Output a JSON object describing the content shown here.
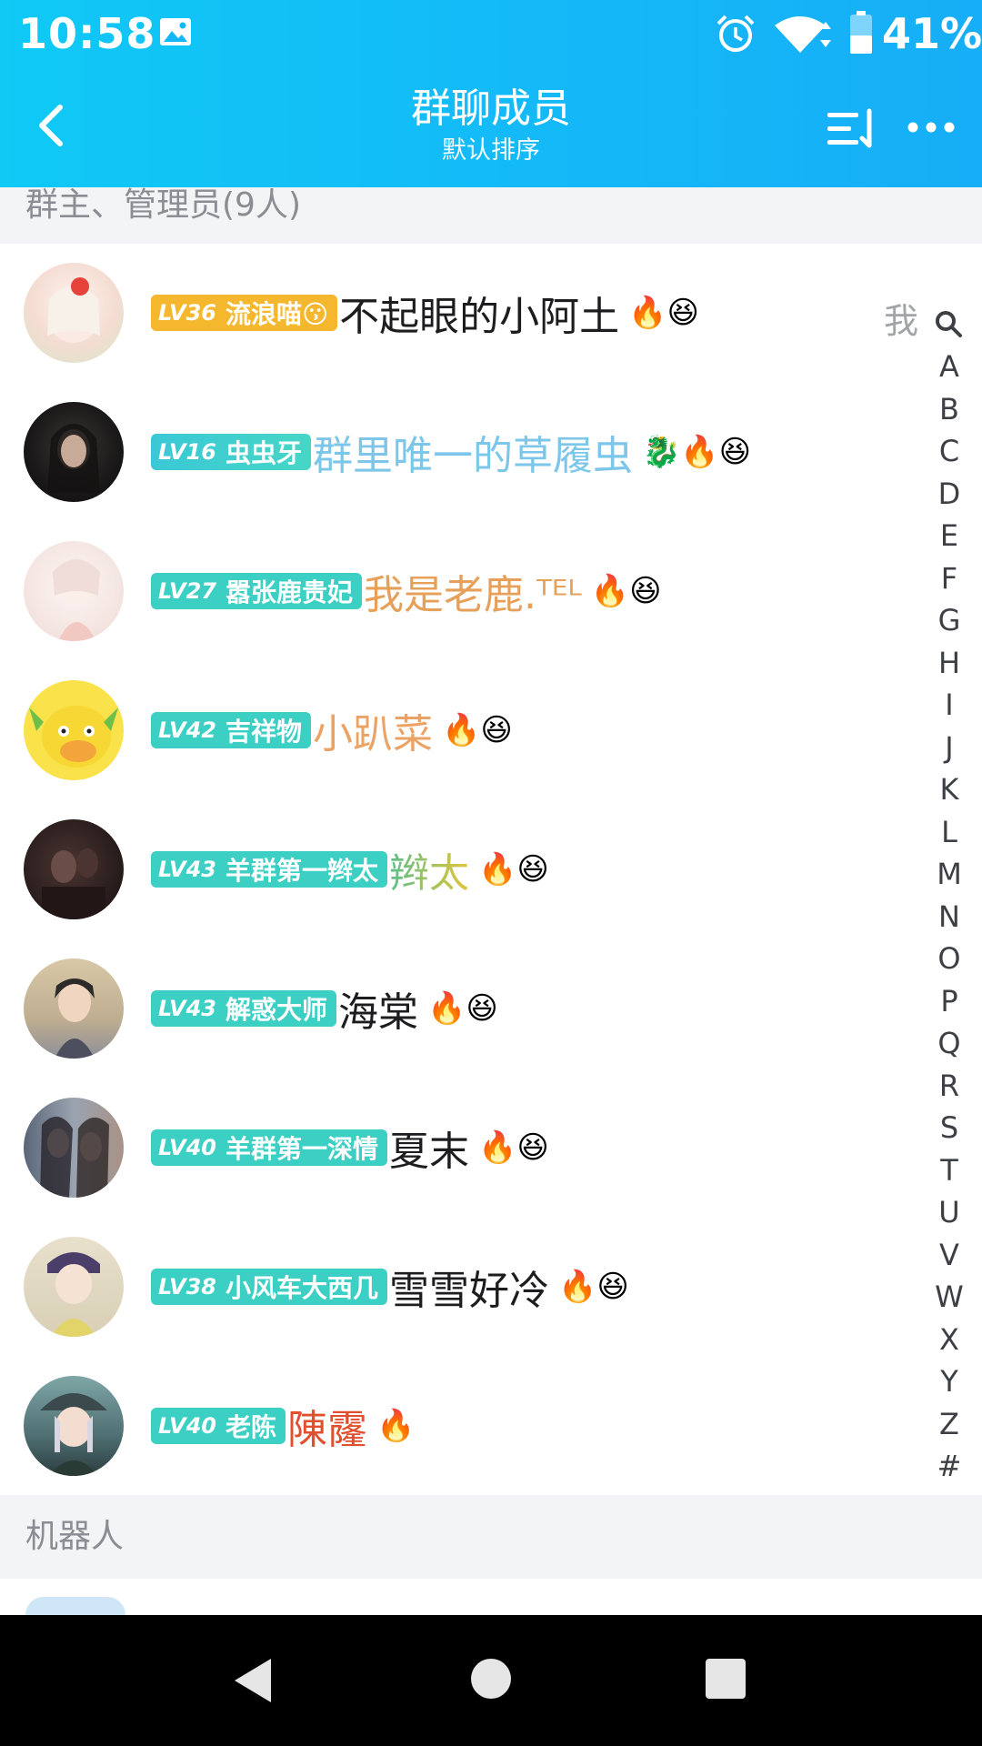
{
  "status_bar": {
    "time": "10:58",
    "battery": "41%"
  },
  "header": {
    "title": "群聊成员",
    "subtitle": "默认排序"
  },
  "sections": {
    "admins_label": "群主、管理员(9人)",
    "robots_label": "机器人"
  },
  "me_label": "我",
  "colors": {
    "header_start": "#10c9f5",
    "header_end": "#16aef6",
    "badge_owner": "#f5b72d",
    "badge_admin": "#3cd1c9"
  },
  "members": [
    {
      "level": "LV36",
      "title": "流浪喵😗",
      "name": "不起眼的小阿土",
      "icons": "🔥😆",
      "badge_color": "#f5b72d",
      "name_color": "#1d1d1f",
      "is_me": true
    },
    {
      "level": "LV16",
      "title": "虫虫牙",
      "name": "群里唯一的草履虫",
      "icons": "🐉🔥😆",
      "badge_color": "#3cd1c9",
      "name_color": "#7cc6ea",
      "is_me": false
    },
    {
      "level": "LV27",
      "title": "嚣张鹿贵妃",
      "name": "我是老鹿.ᵀᴱᴸ",
      "icons": "🔥😆",
      "badge_color": "#3cd1c9",
      "name_color": "#e6a05a",
      "is_me": false
    },
    {
      "level": "LV42",
      "title": "吉祥物",
      "name": "小趴菜",
      "icons": "🔥😆",
      "badge_color": "#3cd1c9",
      "name_color": "#eba365",
      "is_me": false
    },
    {
      "level": "LV43",
      "title": "羊群第一辫太",
      "name": "辫太",
      "icons": "🔥😆",
      "badge_color": "#3cd1c9",
      "name_color": "#7fc47a",
      "is_me": false
    },
    {
      "level": "LV43",
      "title": "解惑大师",
      "name": "海棠",
      "icons": "🔥😆",
      "badge_color": "#3cd1c9",
      "name_color": "#1d1d1f",
      "is_me": false
    },
    {
      "level": "LV40",
      "title": "羊群第一深情",
      "name": "夏末",
      "icons": "🔥😆",
      "badge_color": "#3cd1c9",
      "name_color": "#1d1d1f",
      "is_me": false
    },
    {
      "level": "LV38",
      "title": "小风车大西几",
      "name": "雪雪好冷",
      "icons": "🔥😆",
      "badge_color": "#3cd1c9",
      "name_color": "#1d1d1f",
      "is_me": false
    },
    {
      "level": "LV40",
      "title": "老陈",
      "name": "陳霳",
      "icons": "🔥",
      "badge_color": "#3cd1c9",
      "name_color": "#e0502e",
      "is_me": false
    }
  ],
  "alpha_index": [
    "A",
    "B",
    "C",
    "D",
    "E",
    "F",
    "G",
    "H",
    "I",
    "J",
    "K",
    "L",
    "M",
    "N",
    "O",
    "P",
    "Q",
    "R",
    "S",
    "T",
    "U",
    "V",
    "W",
    "X",
    "Y",
    "Z",
    "#"
  ]
}
